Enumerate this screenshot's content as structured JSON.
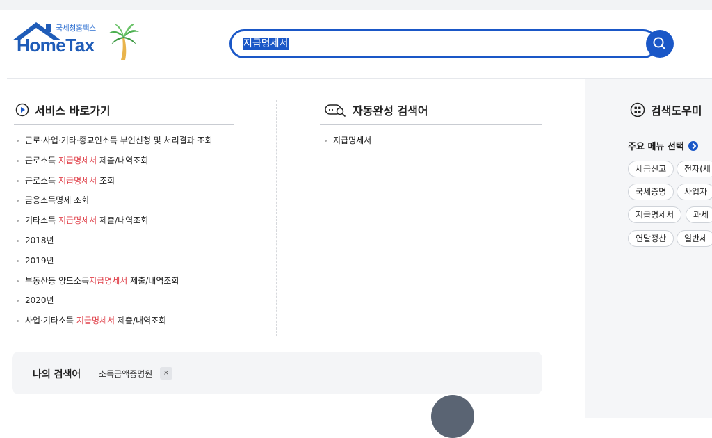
{
  "header": {
    "logo_sub": "국세청홈택스",
    "logo_main": "HomeTax"
  },
  "search": {
    "value": "지급명세서",
    "button_icon": "search-icon"
  },
  "service": {
    "title": "서비스 바로가기",
    "items": [
      {
        "pre": "근로·사업·기타·종교인소득 부인신청 및 처리결과 조회",
        "hl": "",
        "post": ""
      },
      {
        "pre": "근로소득 ",
        "hl": "지급명세서",
        "post": " 제출/내역조회"
      },
      {
        "pre": "근로소득 ",
        "hl": "지급명세서",
        "post": " 조회"
      },
      {
        "pre": "금융소득명세 조회",
        "hl": "",
        "post": ""
      },
      {
        "pre": "기타소득 ",
        "hl": "지급명세서",
        "post": " 제출/내역조회"
      },
      {
        "pre": "2018년",
        "hl": "",
        "post": ""
      },
      {
        "pre": "2019년",
        "hl": "",
        "post": ""
      },
      {
        "pre": "부동산등 양도소득",
        "hl": "지급명세서",
        "post": " 제출/내역조회"
      },
      {
        "pre": "2020년",
        "hl": "",
        "post": ""
      },
      {
        "pre": "사업·기타소득 ",
        "hl": "지급명세서",
        "post": " 제출/내역조회"
      }
    ]
  },
  "autocomplete": {
    "title": "자동완성 검색어",
    "items": [
      "지급명세서"
    ]
  },
  "help": {
    "title": "검색도우미",
    "menu_select": "주요 메뉴 선택",
    "chips": [
      "세금신고",
      "전자(세",
      "국세증명",
      "사업자",
      "지급명세서",
      "과세",
      "연말정산",
      "일반세"
    ]
  },
  "my_search": {
    "label": "나의 검색어",
    "items": [
      "소득금액증명원"
    ],
    "remove": "×"
  },
  "colors": {
    "brand": "#1a57c7",
    "highlight": "#e0424b"
  }
}
